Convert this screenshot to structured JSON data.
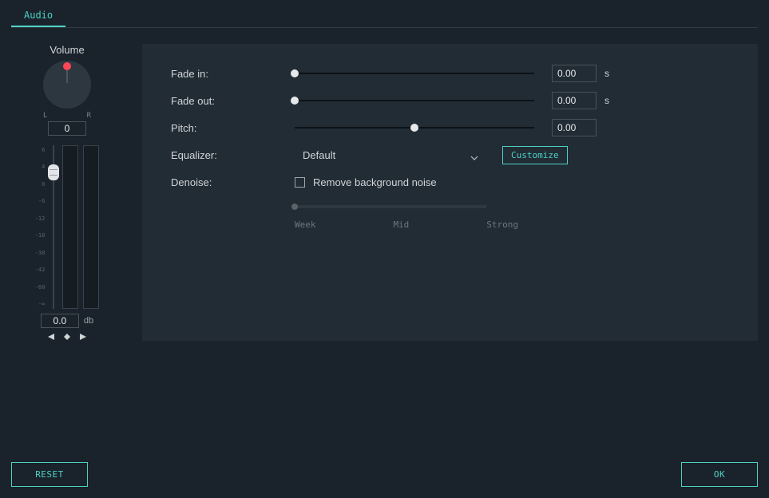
{
  "tab": {
    "label": "Audio"
  },
  "volume": {
    "title": "Volume",
    "lr_left": "L",
    "lr_right": "R",
    "pan_value": "0",
    "scale_ticks": [
      "6",
      "4",
      "0",
      "-6",
      "-12",
      "-18",
      "-30",
      "-42",
      "-60",
      "-∞"
    ],
    "db_value": "0.0",
    "db_unit": "db"
  },
  "params": {
    "fade_in": {
      "label": "Fade in:",
      "value": "0.00",
      "unit": "s",
      "thumb_at_start": true
    },
    "fade_out": {
      "label": "Fade out:",
      "value": "0.00",
      "unit": "s",
      "thumb_at_start": true
    },
    "pitch": {
      "label": "Pitch:",
      "value": "0.00",
      "thumb_at_start": false
    },
    "equalizer": {
      "label": "Equalizer:",
      "selected": "Default",
      "customize": "Customize"
    },
    "denoise": {
      "label": "Denoise:",
      "checkbox_label": "Remove background noise",
      "scale": {
        "weak": "Week",
        "mid": "Mid",
        "strong": "Strong"
      }
    }
  },
  "footer": {
    "reset": "RESET",
    "ok": "OK"
  }
}
